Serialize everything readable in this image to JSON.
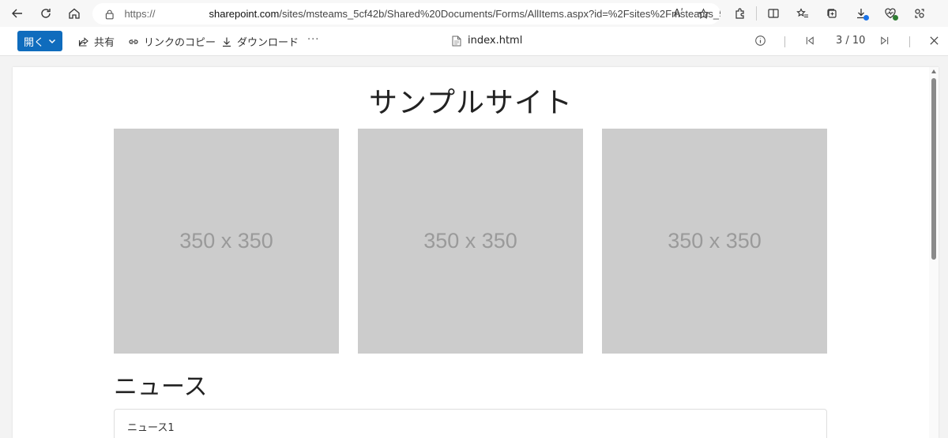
{
  "browser": {
    "url_scheme": "https://",
    "url_domain": "sharepoint.com",
    "url_path": "/sites/msteams_5cf42b/Shared%20Documents/Forms/AllItems.aspx?id=%2Fsites%2Fmsteams_5cf...",
    "read_aloud_label": "Aʹ"
  },
  "toolbar": {
    "open_label": "開く",
    "share_label": "共有",
    "copy_link_label": "リンクのコピー",
    "download_label": "ダウンロード",
    "more_label": "···",
    "file_name": "index.html",
    "page_counter": "3 / 10"
  },
  "page": {
    "title": "サンプルサイト",
    "images": [
      {
        "label": "350 x 350"
      },
      {
        "label": "350 x 350"
      },
      {
        "label": "350 x 350"
      }
    ],
    "news_heading": "ニュース",
    "news_items": [
      "ニュース1"
    ]
  }
}
